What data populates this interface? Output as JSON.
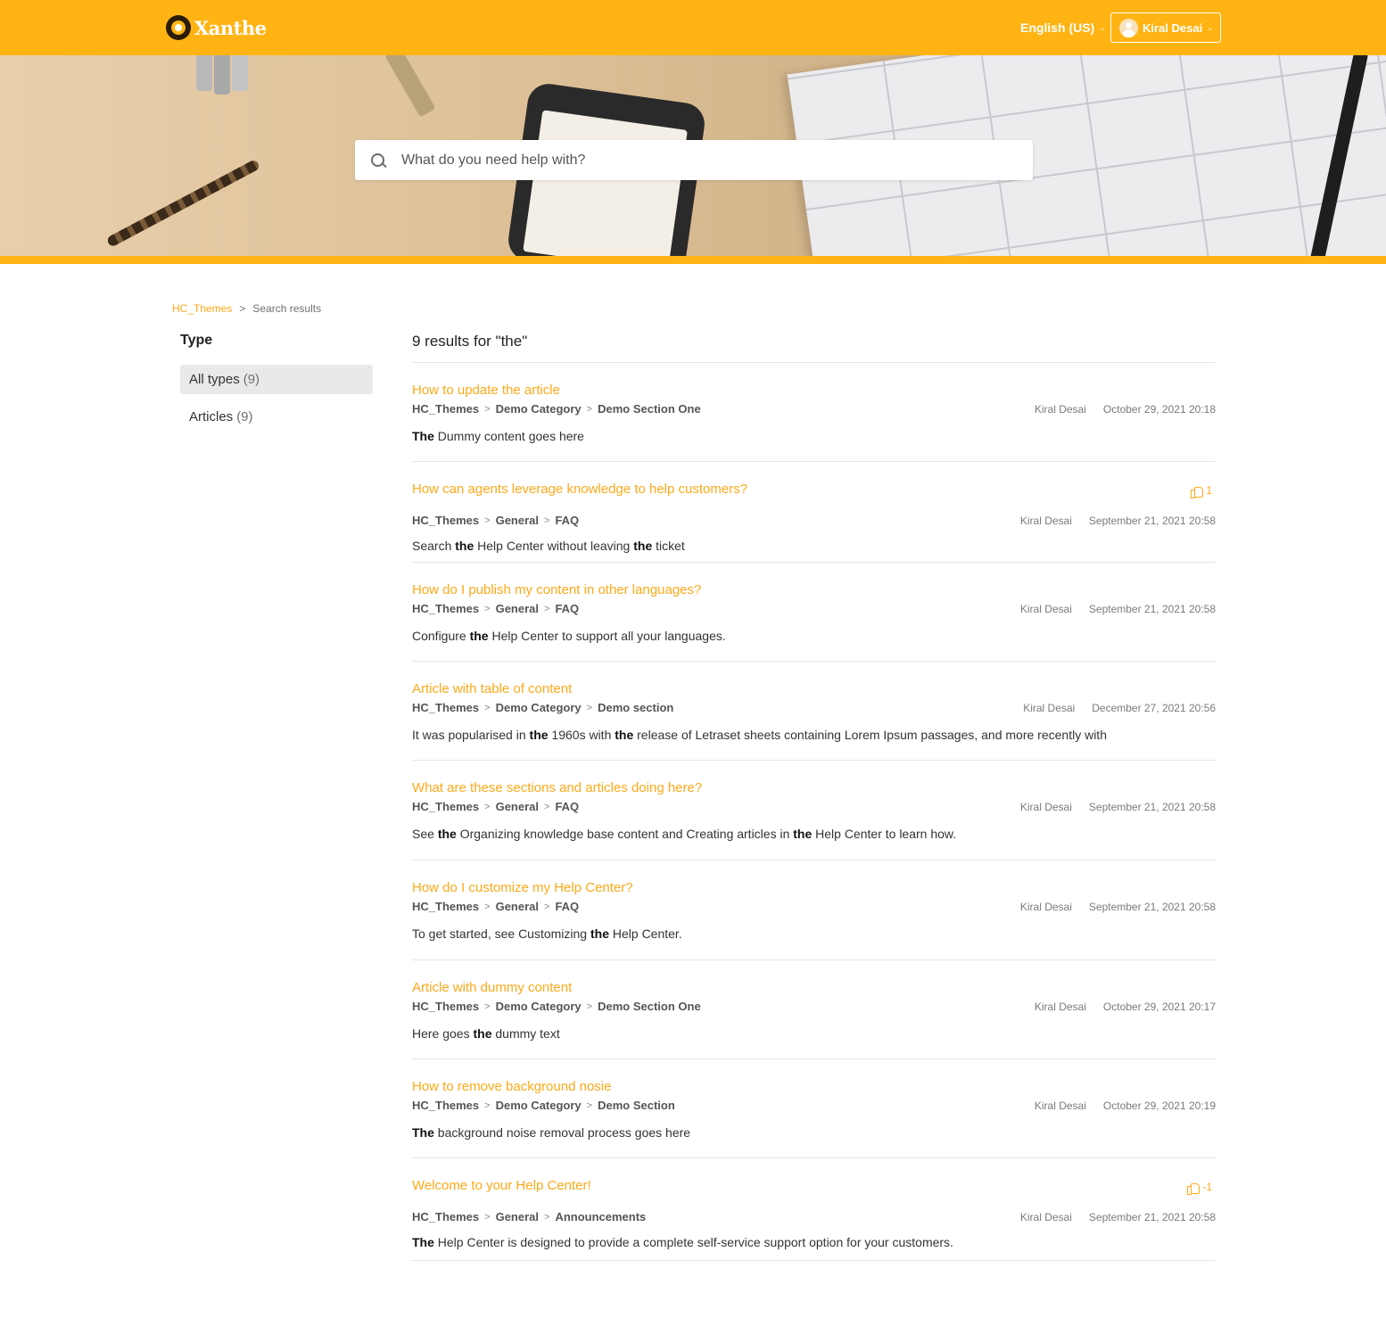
{
  "header": {
    "brand": "Xanthe",
    "language": "English (US)",
    "user": "Kiral Desai",
    "accent": "#ffb414"
  },
  "search": {
    "placeholder": "What do you need help with?"
  },
  "breadcrumb": {
    "home": "HC_Themes",
    "sep": ">",
    "current": "Search results"
  },
  "sidebar": {
    "title": "Type",
    "items": [
      {
        "label": "All types",
        "count": "(9)",
        "active": true
      },
      {
        "label": "Articles",
        "count": "(9)",
        "active": false
      }
    ]
  },
  "results": {
    "heading": "9 results for \"the\"",
    "items": [
      {
        "title": "How to update the article",
        "path": [
          "HC_Themes",
          "Demo Category",
          "Demo Section One"
        ],
        "author": "Kiral Desai",
        "date": "October 29, 2021 20:18",
        "vote": "",
        "snippet": [
          [
            "The",
            true
          ],
          [
            " Dummy content goes here",
            false
          ]
        ]
      },
      {
        "title": "How can agents leverage knowledge to help customers?",
        "path": [
          "HC_Themes",
          "General",
          "FAQ"
        ],
        "author": "Kiral Desai",
        "date": "September 21, 2021 20:58",
        "vote": "1",
        "snippet": [
          [
            "Search ",
            false
          ],
          [
            "the",
            true
          ],
          [
            " Help Center without leaving ",
            false
          ],
          [
            "the",
            true
          ],
          [
            " ticket",
            false
          ]
        ]
      },
      {
        "title": "How do I publish my content in other languages?",
        "path": [
          "HC_Themes",
          "General",
          "FAQ"
        ],
        "author": "Kiral Desai",
        "date": "September 21, 2021 20:58",
        "vote": "",
        "snippet": [
          [
            "Configure ",
            false
          ],
          [
            "the",
            true
          ],
          [
            " Help Center to support all your languages.",
            false
          ]
        ]
      },
      {
        "title": "Article with table of content",
        "path": [
          "HC_Themes",
          "Demo Category",
          "Demo section"
        ],
        "author": "Kiral Desai",
        "date": "December 27, 2021 20:56",
        "vote": "",
        "snippet": [
          [
            "It was popularised in ",
            false
          ],
          [
            "the",
            true
          ],
          [
            " 1960s with ",
            false
          ],
          [
            "the",
            true
          ],
          [
            " release of Letraset sheets containing Lorem Ipsum passages, and more recently with",
            false
          ]
        ]
      },
      {
        "title": "What are these sections and articles doing here?",
        "path": [
          "HC_Themes",
          "General",
          "FAQ"
        ],
        "author": "Kiral Desai",
        "date": "September 21, 2021 20:58",
        "vote": "",
        "snippet": [
          [
            "See ",
            false
          ],
          [
            "the",
            true
          ],
          [
            " Organizing knowledge base content and Creating articles in ",
            false
          ],
          [
            "the",
            true
          ],
          [
            " Help Center to learn how.",
            false
          ]
        ]
      },
      {
        "title": "How do I customize my Help Center?",
        "path": [
          "HC_Themes",
          "General",
          "FAQ"
        ],
        "author": "Kiral Desai",
        "date": "September 21, 2021 20:58",
        "vote": "",
        "snippet": [
          [
            "To get started, see Customizing ",
            false
          ],
          [
            "the",
            true
          ],
          [
            " Help Center.",
            false
          ]
        ]
      },
      {
        "title": "Article with dummy content",
        "path": [
          "HC_Themes",
          "Demo Category",
          "Demo Section One"
        ],
        "author": "Kiral Desai",
        "date": "October 29, 2021 20:17",
        "vote": "",
        "snippet": [
          [
            "Here goes ",
            false
          ],
          [
            "the",
            true
          ],
          [
            " dummy text",
            false
          ]
        ]
      },
      {
        "title": "How to remove background nosie",
        "path": [
          "HC_Themes",
          "Demo Category",
          "Demo Section"
        ],
        "author": "Kiral Desai",
        "date": "October 29, 2021 20:19",
        "vote": "",
        "snippet": [
          [
            "The",
            true
          ],
          [
            " background noise removal process goes here",
            false
          ]
        ]
      },
      {
        "title": "Welcome to your Help Center!",
        "path": [
          "HC_Themes",
          "General",
          "Announcements"
        ],
        "author": "Kiral Desai",
        "date": "September 21, 2021 20:58",
        "vote": "-1",
        "snippet": [
          [
            "The",
            true
          ],
          [
            " Help Center is designed to provide a complete self-service support option for your customers.",
            false
          ]
        ]
      }
    ]
  }
}
